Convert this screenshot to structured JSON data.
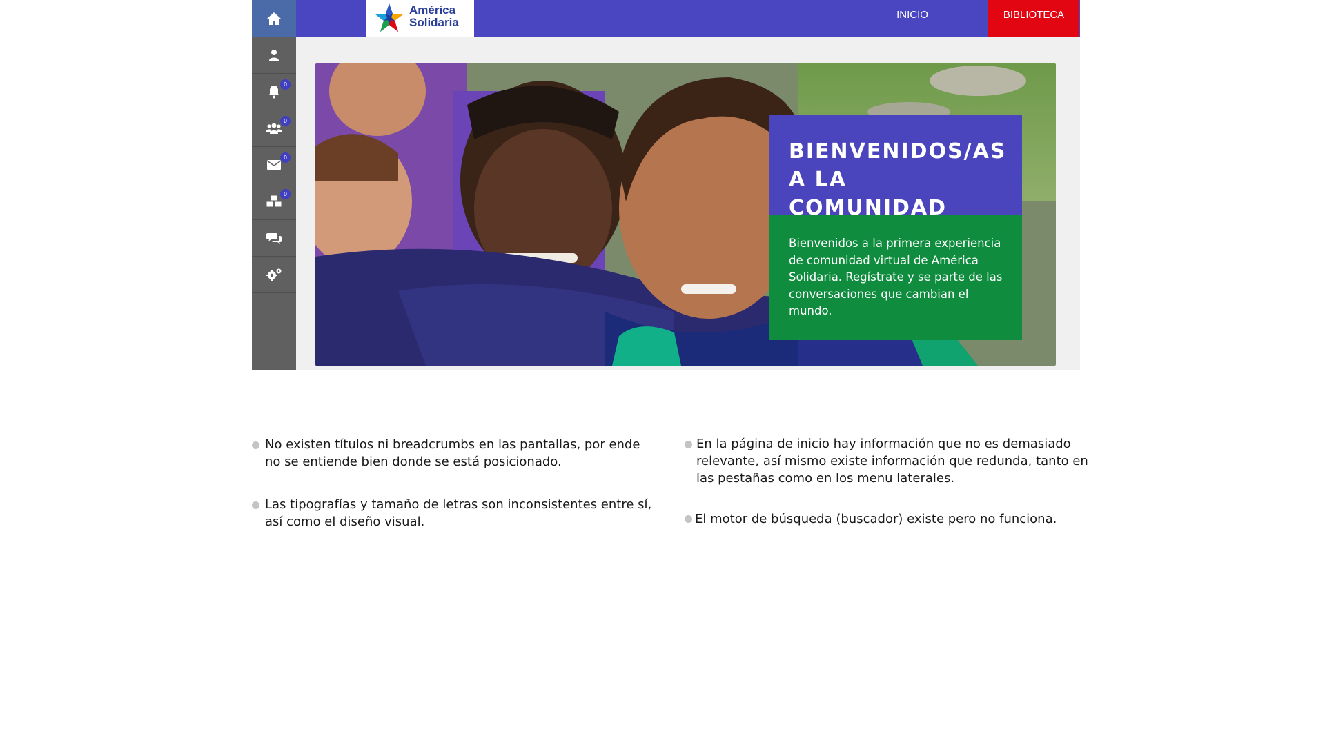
{
  "topbar": {
    "logo": {
      "line1": "América",
      "line2": "Solidaria"
    },
    "nav": [
      {
        "label": "INICIO"
      },
      {
        "label": "BIBLIOTECA",
        "active": true
      }
    ],
    "colors": {
      "bar": "#4a45c0",
      "active": "#e10612"
    }
  },
  "sidebar": {
    "items": [
      {
        "icon": "home-icon"
      },
      {
        "icon": "user-icon"
      },
      {
        "icon": "bell-icon",
        "badge": "0"
      },
      {
        "icon": "users-icon",
        "badge": "0"
      },
      {
        "icon": "envelope-icon",
        "badge": "0"
      },
      {
        "icon": "cubes-icon",
        "badge": "0"
      },
      {
        "icon": "chat-icon"
      },
      {
        "icon": "gears-icon"
      }
    ]
  },
  "hero": {
    "title": "BIENVENIDOS/AS A LA COMUNIDAD",
    "body": "Bienvenidos a la primera experiencia de comunidad virtual de América Solidaria. Regístrate y se parte de las conversaciones que cambian el mundo.",
    "colors": {
      "title_bg": "#4b45bd",
      "body_bg": "#0f8c3e"
    }
  },
  "notes": {
    "left": [
      "No existen títulos ni breadcrumbs en las pantallas, por ende no se entiende bien donde se está posicionado.",
      "Las tipografías y tamaño de letras son inconsistentes entre sí, así como el diseño visual."
    ],
    "right": [
      "En la página de inicio hay información que no es demasiado relevante, así mismo existe información que redunda, tanto en las pestañas como en los menu laterales.",
      "El motor de búsqueda (buscador) existe pero no funciona."
    ]
  }
}
